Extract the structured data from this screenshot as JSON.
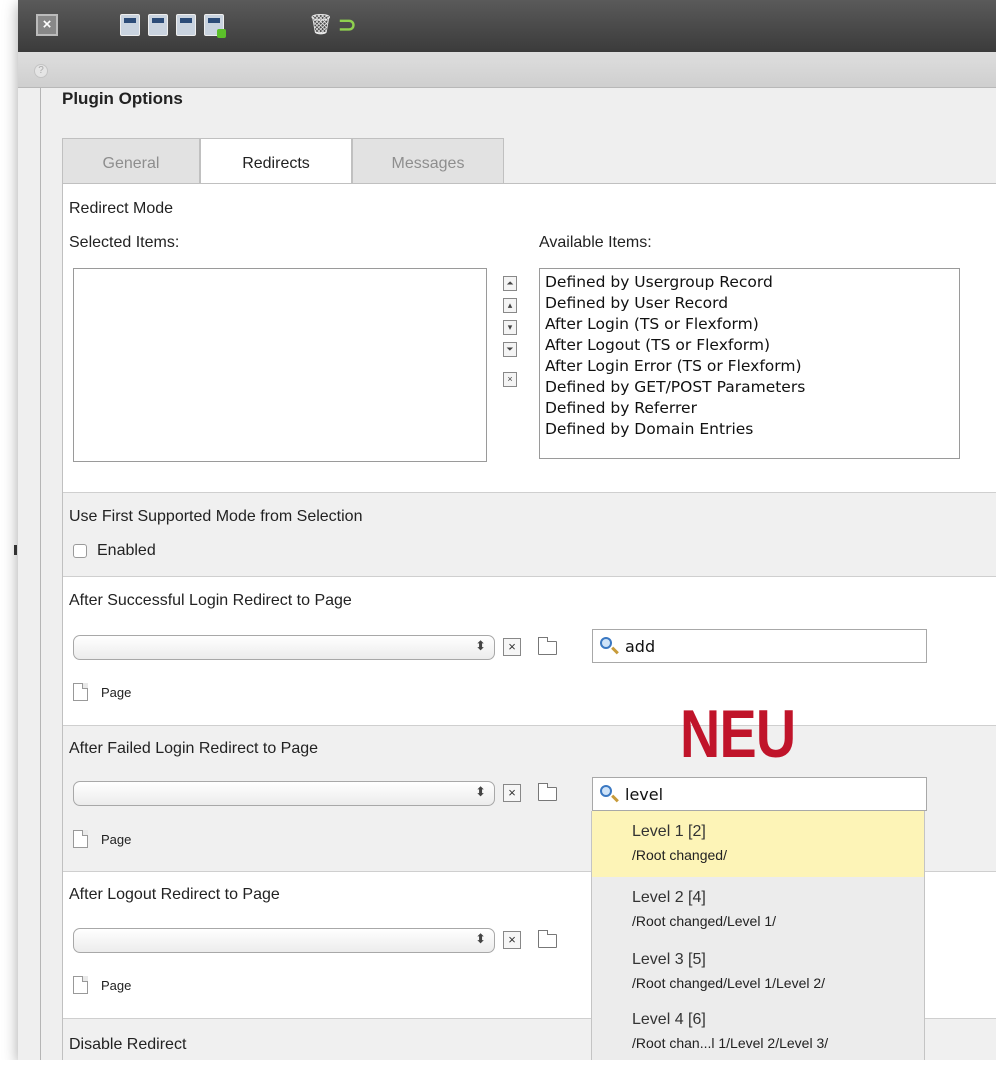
{
  "toolbar": {
    "icons": [
      "close-icon",
      "save-icon",
      "save-view-icon",
      "save-close-icon",
      "save-new-icon",
      "delete-icon",
      "undo-icon"
    ]
  },
  "section_title": "Plugin Options",
  "tabs": [
    {
      "label": "General",
      "active": false
    },
    {
      "label": "Redirects",
      "active": true
    },
    {
      "label": "Messages",
      "active": false
    }
  ],
  "redirect_mode": {
    "label": "Redirect Mode",
    "selected_label": "Selected Items:",
    "available_label": "Available Items:",
    "selected_items": [],
    "available_items": [
      "Defined by Usergroup Record",
      "Defined by User Record",
      "After Login (TS or Flexform)",
      "After Logout (TS or Flexform)",
      "After Login Error (TS or Flexform)",
      "Defined by GET/POST Parameters",
      "Defined by Referrer",
      "Defined by Domain Entries"
    ]
  },
  "first_supported": {
    "label": "Use First Supported Mode from Selection",
    "checkbox_label": "Enabled",
    "checked": false
  },
  "login_redirect": {
    "label": "After Successful Login Redirect to Page",
    "search_value": "add",
    "page_label": "Page"
  },
  "failed_redirect": {
    "label": "After Failed Login Redirect to Page",
    "search_value": "level",
    "page_label": "Page"
  },
  "logout_redirect": {
    "label": "After Logout Redirect to Page",
    "page_label": "Page"
  },
  "disable_redirect": {
    "label": "Disable Redirect"
  },
  "annotation": "NEU",
  "suggestions": [
    {
      "title": "Level 1 [2]",
      "path": "/Root changed/",
      "highlighted": true
    },
    {
      "title": "Level 2 [4]",
      "path": "/Root changed/Level 1/",
      "highlighted": false
    },
    {
      "title": "Level 3 [5]",
      "path": "/Root changed/Level 1/Level 2/",
      "highlighted": false
    },
    {
      "title": "Level 4 [6]",
      "path": "/Root chan...l 1/Level 2/Level 3/",
      "highlighted": false
    }
  ],
  "colors": {
    "annotation_red": "#c0142a",
    "highlight": "#fdf4b7",
    "toolbar_dark": "#3b3b3b"
  }
}
